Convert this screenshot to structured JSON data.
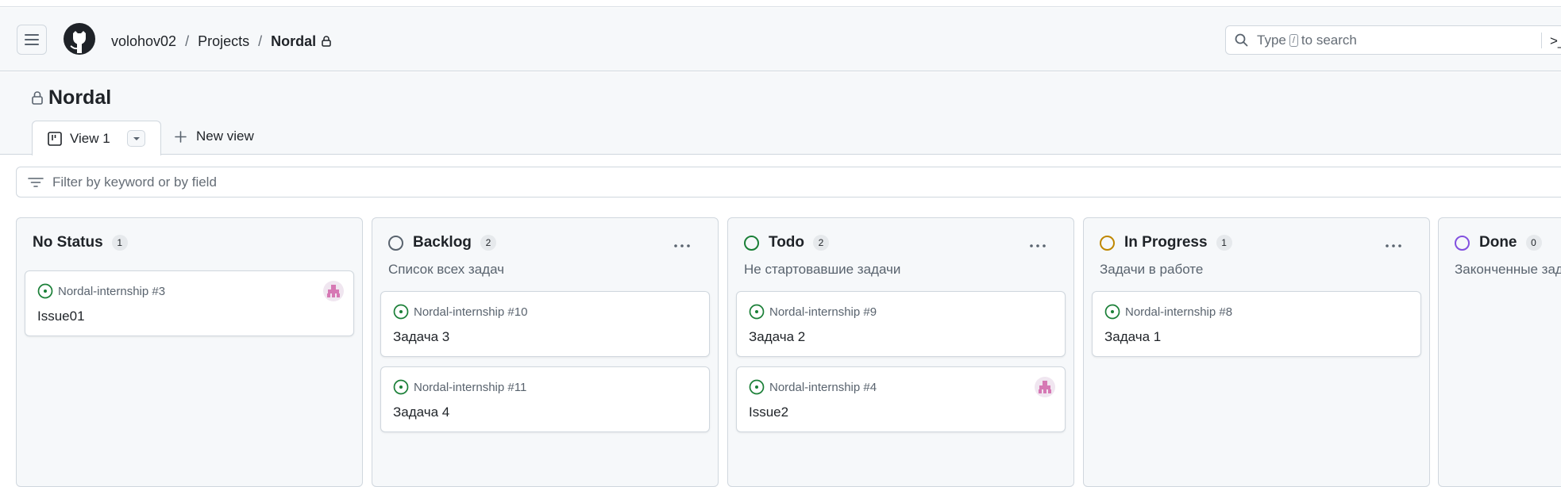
{
  "header": {
    "breadcrumb": [
      "volohov02",
      "Projects",
      "Nordal"
    ],
    "separator": "/",
    "search_prefix": "Type",
    "search_key": "/",
    "search_suffix": "to search",
    "command_glyph": ">_"
  },
  "project": {
    "title": "Nordal",
    "view_tab_label": "View 1",
    "new_view_label": "New view",
    "filter_placeholder": "Filter by keyword or by field"
  },
  "columns": [
    {
      "title": "No Status",
      "count": "1",
      "description": "",
      "status_color": "",
      "cards": [
        {
          "ref": "Nordal-internship #3",
          "title": "Issue01",
          "has_avatar": true
        }
      ]
    },
    {
      "title": "Backlog",
      "count": "2",
      "description": "Список всех задач",
      "status_color": "#59636e",
      "cards": [
        {
          "ref": "Nordal-internship #10",
          "title": "Задача 3",
          "has_avatar": false
        },
        {
          "ref": "Nordal-internship #11",
          "title": "Задача 4",
          "has_avatar": false
        }
      ]
    },
    {
      "title": "Todo",
      "count": "2",
      "description": "Не стартовавшие задачи",
      "status_color": "#1a7f37",
      "cards": [
        {
          "ref": "Nordal-internship #9",
          "title": "Задача 2",
          "has_avatar": false
        },
        {
          "ref": "Nordal-internship #4",
          "title": "Issue2",
          "has_avatar": true
        }
      ]
    },
    {
      "title": "In Progress",
      "count": "1",
      "description": "Задачи в работе",
      "status_color": "#bf8700",
      "cards": [
        {
          "ref": "Nordal-internship #8",
          "title": "Задача 1",
          "has_avatar": false
        }
      ]
    },
    {
      "title": "Done",
      "count": "0",
      "description": "Законченные задачи",
      "status_color": "#8250df",
      "cards": []
    }
  ],
  "colors": {
    "issue_open": "#1a7f37",
    "border": "#d0d7de",
    "canvas_subtle": "#f6f8fa",
    "avatar_accent": "#d678b4"
  },
  "icons": {
    "menu": "hamburger-icon",
    "logo": "github-logo",
    "lock": "lock-icon",
    "search": "search-icon",
    "board": "board-view-icon",
    "dropdown": "triangle-down-icon",
    "plus": "plus-icon",
    "filter": "filter-icon",
    "issue": "issue-opened-icon",
    "more": "kebab-horizontal-icon"
  }
}
